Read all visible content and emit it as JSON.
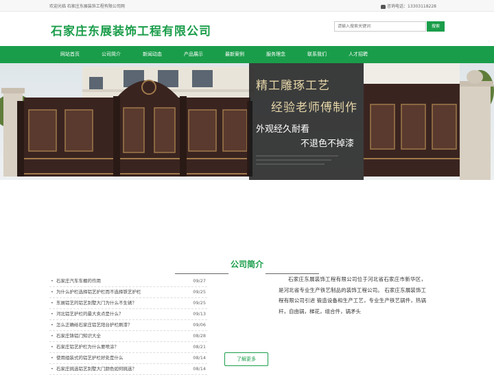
{
  "topbar": {
    "welcome": "欢迎光临 石家庄东展装饰工程有限公司网",
    "phone_label": "咨询电话：13303118228"
  },
  "header": {
    "company_name": "石家庄东展装饰工程有限公司",
    "search_placeholder": "请输入搜索关键词",
    "search_button": "搜索"
  },
  "nav": {
    "items": [
      "网站首页",
      "公司简介",
      "新闻动态",
      "产品展示",
      "最新案例",
      "服务理念",
      "联系我们",
      "人才招聘"
    ]
  },
  "banner": {
    "headline_1": "精工雕琢工艺",
    "headline_2": "经验老师傅制作",
    "tagline_1": "外观经久耐看",
    "tagline_2": "不退色不掉漆"
  },
  "about": {
    "title": "公司简介",
    "text": "石家庄东展装饰工程有限公司位于河北省石家庄市新华区，是河北省专业生产铁艺制品的装饰工程公司。 石家庄东展装饰工程有限公司引进 锻造设备和生产工艺，专业生产铁艺锅件，热锅杆，自由锅，梯花，组合件，锅矛头",
    "more_button": "了解更多"
  },
  "news": [
    {
      "title": "石家庄汽车车棚的作用",
      "date": "09/27"
    },
    {
      "title": "为什么护栏选择铝艺护栏而不选择铁艺护栏",
      "date": "09/25"
    },
    {
      "title": "东展铝艺的铝艺别墅大门为什么不生锈？",
      "date": "09/25"
    },
    {
      "title": "河北铝艺护栏的最大卖点是什么？",
      "date": "09/13"
    },
    {
      "title": "怎么正确给石家庄铝艺阳台护栏刷漆？",
      "date": "09/06"
    },
    {
      "title": "石家庄铸铝门知识大全",
      "date": "08/28"
    },
    {
      "title": "石家庄铝艺护栏为什么要喷涂？",
      "date": "08/21"
    },
    {
      "title": "使用组装式的铝艺护栏好处是什么",
      "date": "08/14"
    },
    {
      "title": "石家庄挑选铝艺别墅大门颜色如何挑选？",
      "date": "08/14"
    }
  ],
  "colors": {
    "brand_green": "#1a9d4a",
    "gate_brown": "#3a2420"
  }
}
